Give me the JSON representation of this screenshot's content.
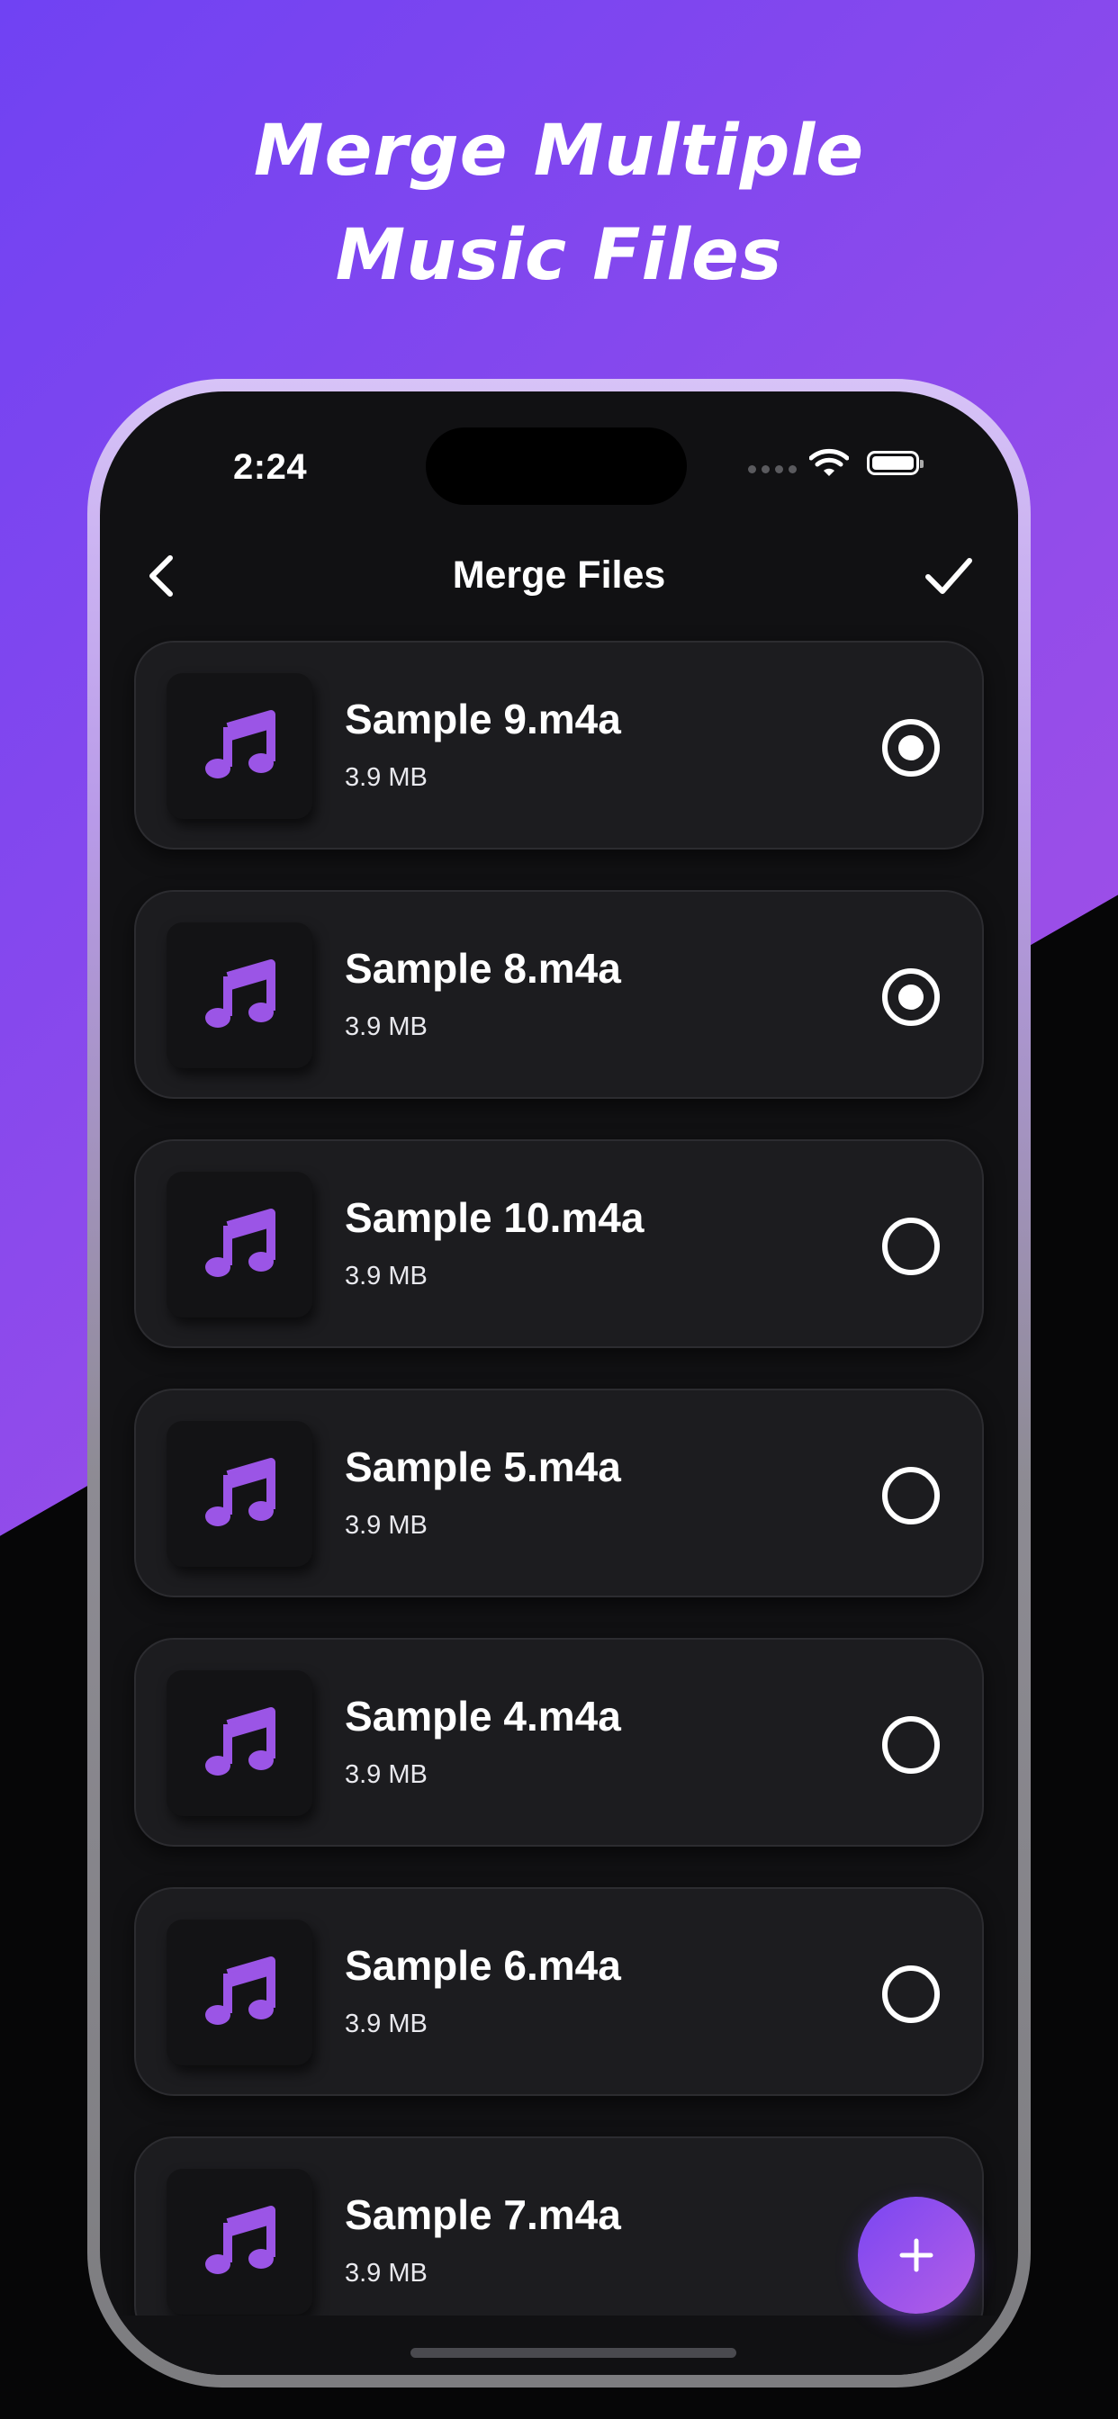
{
  "promo": {
    "headline_line1": "Merge Multiple",
    "headline_line2": "Music Files"
  },
  "status_bar": {
    "time": "2:24"
  },
  "nav": {
    "title": "Merge Files"
  },
  "files": [
    {
      "name": "Sample 9.m4a",
      "size": "3.9 MB",
      "selected": true
    },
    {
      "name": "Sample 8.m4a",
      "size": "3.9 MB",
      "selected": true
    },
    {
      "name": "Sample 10.m4a",
      "size": "3.9 MB",
      "selected": false
    },
    {
      "name": "Sample 5.m4a",
      "size": "3.9 MB",
      "selected": false
    },
    {
      "name": "Sample 4.m4a",
      "size": "3.9 MB",
      "selected": false
    },
    {
      "name": "Sample 6.m4a",
      "size": "3.9 MB",
      "selected": false
    },
    {
      "name": "Sample 7.m4a",
      "size": "3.9 MB",
      "selected": false
    }
  ],
  "icons": {
    "back": "chevron-left-icon",
    "confirm": "checkmark-icon",
    "file": "music-note-icon",
    "add": "plus-icon"
  },
  "colors": {
    "accent": "#9b55e6",
    "gradient_start": "#7042f3",
    "gradient_end": "#b05be8",
    "card": "#1c1c1f"
  }
}
